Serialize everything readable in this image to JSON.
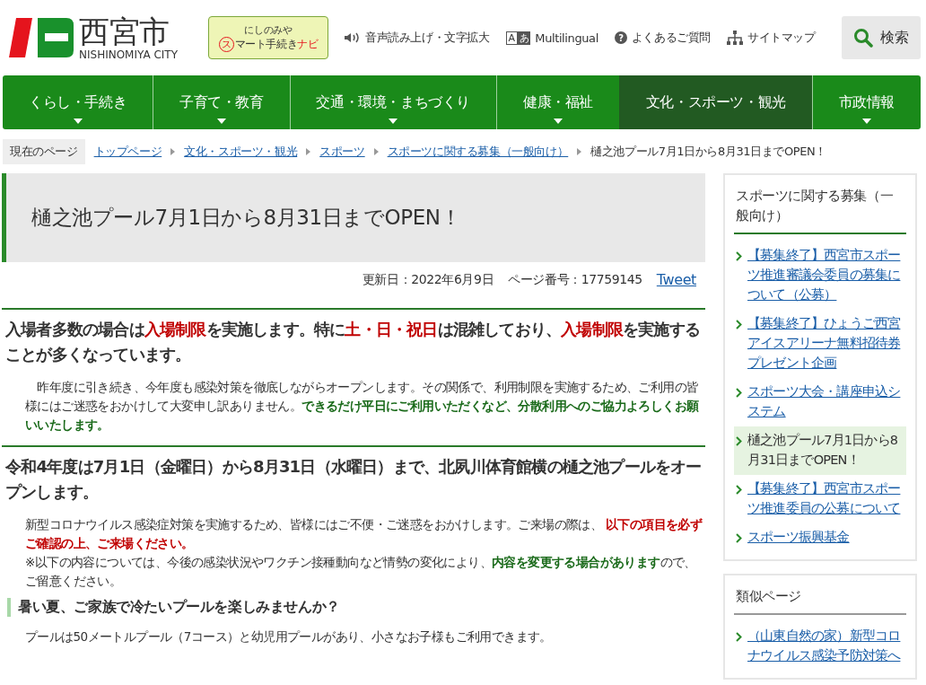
{
  "header": {
    "logo_text": "西宮市",
    "logo_sub": "NISHINOMIYA CITY",
    "banner": {
      "line1": "にしのみや",
      "mark": "ス",
      "line2": "マート手続き",
      "line3": "ナビ"
    },
    "utility_links": [
      {
        "label": "音声読み上げ・文字拡大",
        "kind": "speaker"
      },
      {
        "label": "Multilingual",
        "kind": "lang",
        "badge_a": "A",
        "badge_b": "あ"
      },
      {
        "label": "よくあるご質問",
        "kind": "help",
        "glyph": "?"
      },
      {
        "label": "サイトマップ",
        "kind": "sitemap"
      }
    ],
    "search_button": "検索"
  },
  "nav": [
    {
      "label": "くらし・手続き",
      "selected": false
    },
    {
      "label": "子育て・教育",
      "selected": false
    },
    {
      "label": "交通・環境・まちづくり",
      "selected": false
    },
    {
      "label": "健康・福祉",
      "selected": false
    },
    {
      "label": "文化・スポーツ・観光",
      "selected": true
    },
    {
      "label": "市政情報",
      "selected": false
    }
  ],
  "breadcrumb": {
    "label": "現在のページ",
    "links": [
      "トップページ",
      "文化・スポーツ・観光",
      "スポーツ",
      "スポーツに関する募集（一般向け）"
    ],
    "current": "樋之池プール7月1日から8月31日までOPEN！"
  },
  "page_title": "樋之池プール7月1日から8月31日までOPEN！",
  "meta": {
    "updated": "更新日：2022年6月9日",
    "page_number": "ページ番号：17759145",
    "tweet": "Tweet"
  },
  "sections": [
    {
      "kind": "h2",
      "runs": [
        {
          "text": "入場者多数の場合は",
          "kind": "plain"
        },
        {
          "text": "入場制限",
          "kind": "red"
        },
        {
          "text": "を実施します。特に",
          "kind": "plain"
        },
        {
          "text": "土・日・祝日",
          "kind": "red"
        },
        {
          "text": "は混雑しており、",
          "kind": "plain"
        },
        {
          "text": "入場制限",
          "kind": "red"
        },
        {
          "text": "を実施することが多くなっています。",
          "kind": "plain"
        }
      ]
    },
    {
      "kind": "p",
      "runs": [
        {
          "text": "　昨年度に引き続き、今年度も感染対策を徹底しながらオープンします。その関係で、利用制限を実施するため、ご利用の皆様にはご迷惑をおかけして大変申し訳ありません。",
          "kind": "plain"
        },
        {
          "text": "できるだけ平日にご利用いただくなど、分散利用へのご協力よろしくお願いいたします。",
          "kind": "green"
        }
      ]
    },
    {
      "kind": "h2",
      "runs": [
        {
          "text": "令和4年度は7月1日（金曜日）から8月31日（水曜日）まで、北夙川体育館横の樋之池プールをオープンします。",
          "kind": "plain"
        }
      ]
    },
    {
      "kind": "p",
      "runs": [
        {
          "text": "新型コロナウイルス感染症対策を実施するため、皆様にはご不便・ご迷惑をおかけします。ご来場の際は、 ",
          "kind": "plain"
        },
        {
          "text": "以下の項目を必ずご確認の上、ご来場ください。",
          "kind": "red"
        }
      ]
    },
    {
      "kind": "p",
      "runs": [
        {
          "text": "※以下の内容については、今後の感染状況やワクチン接種動向など情勢の変化により、",
          "kind": "plain"
        },
        {
          "text": "内容を変更する場合があります",
          "kind": "green"
        },
        {
          "text": "ので、ご留意ください。",
          "kind": "plain"
        }
      ]
    },
    {
      "kind": "h3",
      "runs": [
        {
          "text": "暑い夏、ご家族で冷たいプールを楽しみませんか？",
          "kind": "plain"
        }
      ]
    },
    {
      "kind": "p",
      "runs": [
        {
          "text": "プールは50メートルプール（7コース）と幼児用プールがあり、小さなお子様もご利用できます。",
          "kind": "plain"
        }
      ]
    }
  ],
  "sidebar": [
    {
      "title": "スポーツに関する募集（一般向け）",
      "kind": "current",
      "items": [
        {
          "label": "【募集終了】西宮市スポーツ推進審議会委員の募集について（公募）",
          "selected": false
        },
        {
          "label": "【募集終了】ひょうご西宮アイスアリーナ無料招待券プレゼント企画",
          "selected": false
        },
        {
          "label": "スポーツ大会・講座申込システム",
          "selected": false
        },
        {
          "label": "樋之池プール7月1日から8月31日までOPEN！",
          "selected": true
        },
        {
          "label": "【募集終了】西宮市スポーツ推進委員の公募について",
          "selected": false
        },
        {
          "label": "スポーツ振興基金",
          "selected": false
        }
      ]
    },
    {
      "title": "類似ページ",
      "kind": "similar",
      "items": [
        {
          "label": "（山東自然の家）新型コロナウイルス感染予防対策へ"
        }
      ]
    }
  ]
}
